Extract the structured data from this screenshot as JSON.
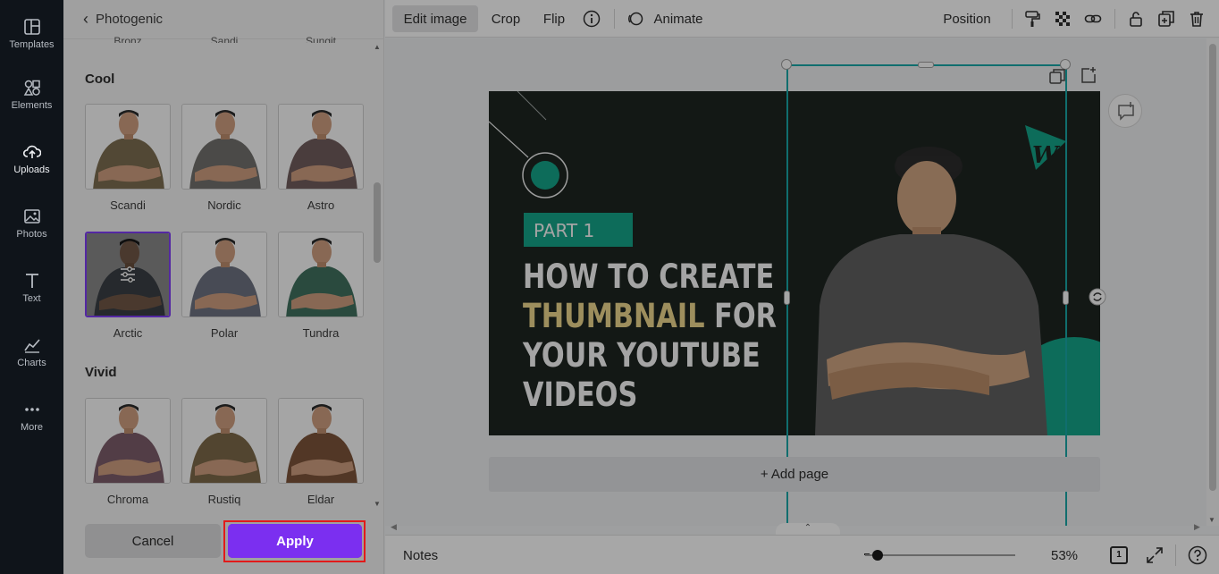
{
  "rail": {
    "items": [
      {
        "label": "Templates",
        "icon": "templates-icon"
      },
      {
        "label": "Elements",
        "icon": "elements-icon"
      },
      {
        "label": "Uploads",
        "icon": "uploads-icon"
      },
      {
        "label": "Photos",
        "icon": "photos-icon"
      },
      {
        "label": "Text",
        "icon": "text-icon"
      },
      {
        "label": "Charts",
        "icon": "charts-icon"
      },
      {
        "label": "More",
        "icon": "more-icon"
      }
    ]
  },
  "panel": {
    "back_label": "Photogenic",
    "cut_labels": [
      "Bronz",
      "Sandi",
      "Sungit"
    ],
    "sections": [
      {
        "title": "Cool",
        "filters": [
          [
            "Scandi",
            "Nordic",
            "Astro"
          ],
          [
            "Arctic",
            "Polar",
            "Tundra"
          ]
        ]
      },
      {
        "title": "Vivid",
        "filters": [
          [
            "Chroma",
            "Rustiq",
            "Eldar"
          ]
        ]
      }
    ],
    "selected_filter": "Arctic",
    "cancel_label": "Cancel",
    "apply_label": "Apply",
    "colors": {
      "apply": "#7b2ff0",
      "selected_border": "#7d3cf0",
      "highlight": "#e21a1a"
    }
  },
  "toolbar": {
    "edit_image": "Edit image",
    "crop": "Crop",
    "flip": "Flip",
    "animate": "Animate",
    "position": "Position"
  },
  "design": {
    "tag": "PART 1",
    "title_line1": "HOW TO CREATE",
    "title_line2_highlight": "THUMBNAIL",
    "title_line2_rest": " FOR",
    "title_line3": "YOUR YOUTUBE",
    "title_line4": "VIDEOS",
    "colors": {
      "background": "#1c2420",
      "accent": "#14a085",
      "highlight_text": "#e8d28a",
      "text": "#f2f2f2"
    }
  },
  "canvas": {
    "add_page": "+ Add page"
  },
  "bottom": {
    "notes": "Notes",
    "zoom": "53%",
    "page_count": "1"
  }
}
